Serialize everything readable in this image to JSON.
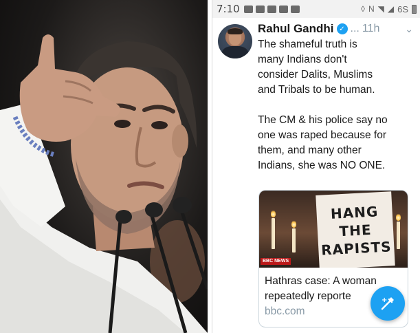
{
  "photo": {
    "subject": "politician-pointing-at-microphones",
    "colors": {
      "background": "#1c1a19",
      "shirt": "#f2f2f0",
      "skin": "#c69a80",
      "hair": "#3a3430"
    }
  },
  "status_bar": {
    "time": "7:10",
    "battery_text": "6S",
    "icons": [
      "notification-icon",
      "mail-icon",
      "video-icon",
      "message-icon",
      "youtube-icon",
      "vibrate-icon",
      "nfc-icon",
      "wifi-icon",
      "signal-icon",
      "battery-icon"
    ]
  },
  "tweet": {
    "author": "Rahul Gandhi",
    "handle": "...",
    "time": "11h",
    "verified": true,
    "paragraph1": [
      "The shameful truth is",
      "many Indians don't",
      "consider Dalits, Muslims",
      "and Tribals to be human."
    ],
    "paragraph2": [
      "The CM & his police say no",
      "one was raped because for",
      "them, and many other",
      "Indians, she was NO ONE."
    ],
    "card": {
      "placard_lines": [
        "HANG",
        "THE",
        "RAPISTS"
      ],
      "title_lines": [
        "Hathras case: A woman",
        "repeatedly reporte"
      ],
      "domain": "bbc.com"
    },
    "colors": {
      "accent": "#1da1f2",
      "muted": "#8899a6",
      "text": "#1a1a1a"
    }
  }
}
